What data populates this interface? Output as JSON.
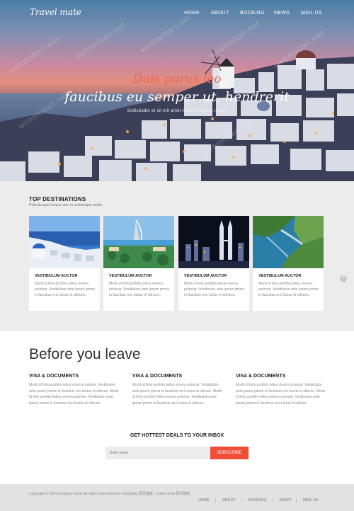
{
  "header": {
    "logo": "Travel mate",
    "nav": [
      "HOME",
      "ABOUT",
      "BOOKING",
      "NEWS",
      "MAIL US"
    ]
  },
  "hero": {
    "title_line1": "Duis purus leo",
    "title_line2": "faucibus eu semper ut, hendrerit",
    "subtitle": "Sollicitudin et sit elit amet luctus placerat ipsum"
  },
  "destinations": {
    "title": "TOP DESTINATIONS",
    "subtitle": "Pellentesque tempor sem in scelerisque mollis.",
    "cards": [
      {
        "title": "VESTIBULUM AUCTOR",
        "text": "Morbi id felis porttitor tellus viverra pulvinar. Vestibulum ante ipsum primis in faucibus orci luctus et ultrices..",
        "image": "santorini-image"
      },
      {
        "title": "VESTIBULUM AUCTOR",
        "text": "Morbi id felis porttitor tellus viverra pulvinar. Vestibulum ante ipsum primis in faucibus orci luctus et ultrices..",
        "image": "dubai-image"
      },
      {
        "title": "VESTIBULUM AUCTOR",
        "text": "Morbi id felis porttitor tellus viverra pulvinar. Vestibulum ante ipsum primis in faucibus orci luctus et ultrices..",
        "image": "city-night-image"
      },
      {
        "title": "VESTIBULUM AUCTOR",
        "text": "Morbi id felis porttitor tellus viverra pulvinar. Vestibulum ante ipsum primis in faucibus orci luctus et ultrices..",
        "image": "coast-image"
      }
    ]
  },
  "before": {
    "title": "Before you leave",
    "columns": [
      {
        "title": "VISA & DOCUMENTS",
        "text": "Morbi id felis porttitor tellus viverra pulvinar. Vestibulum ante ipsum primis in faucibus orci luctus et ultrices. Morbi id felis porttitor tellus viverra pulvinar. Vestibulum ante ipsum primis in faucibus orci luctus et ultrices."
      },
      {
        "title": "VISA & DOCUMENTS",
        "text": "Morbi id felis porttitor tellus viverra pulvinar. Vestibulum ante ipsum primis in faucibus orci luctus et ultrices. Morbi id felis porttitor tellus viverra pulvinar. Vestibulum ante ipsum primis in faucibus orci luctus et ultrices."
      },
      {
        "title": "VISA & DOCUMENTS",
        "text": "Morbi id felis porttitor tellus viverra pulvinar. Vestibulum ante ipsum primis in faucibus orci luctus et ultrices. Morbi id felis porttitor tellus viverra pulvinar. Vestibulum ante ipsum primis in faucibus orci luctus et ultrices."
      }
    ],
    "deals_title": "GET HOTTEST DEALS TO YOUR INBOX",
    "email_placeholder": "Enter email",
    "subscribe_label": "SUBSCRIBE"
  },
  "footer": {
    "copyright": "Copyright © 2014.Company name All rights reserved.More Templates 网页模板 - Collect from 网页模板",
    "nav": [
      "HOME",
      "ABOUT",
      "BOOKING",
      "NEWS",
      "MAIL US"
    ]
  },
  "colors": {
    "accent": "#f04e37",
    "hero_title": "#f06a55",
    "section_bg": "#ececec",
    "footer_bg": "#e2e2e2"
  },
  "icons": {
    "scroll_up": "chevron-up-icon"
  },
  "watermark": "webmoban.net"
}
